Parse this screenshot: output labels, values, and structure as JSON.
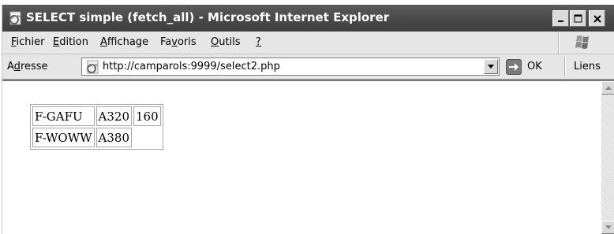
{
  "window": {
    "title": "SELECT simple (fetch_all) - Microsoft Internet Explorer"
  },
  "menu": [
    {
      "pre": "",
      "ul": "F",
      "post": "ichier"
    },
    {
      "pre": "",
      "ul": "E",
      "post": "dition"
    },
    {
      "pre": "",
      "ul": "A",
      "post": "ffichage"
    },
    {
      "pre": "Fa",
      "ul": "v",
      "post": "oris"
    },
    {
      "pre": "",
      "ul": "O",
      "post": "utils"
    },
    {
      "pre": "",
      "ul": "?",
      "post": ""
    }
  ],
  "address": {
    "label_pre": "A",
    "label_ul": "d",
    "label_post": "resse",
    "url": "http://camparols:9999/select2.php",
    "go_label": "OK",
    "links_label": "Liens"
  },
  "table": {
    "rows": [
      [
        "F-GAFU",
        "A320",
        "160"
      ],
      [
        "F-WOWW",
        "A380",
        ""
      ]
    ]
  },
  "icons": {
    "app": "ie-page-icon",
    "minimize": "minimize-icon",
    "maximize": "maximize-icon",
    "close": "close-icon",
    "go": "go-arrow-icon",
    "dropdown": "chevron-down-icon",
    "scroll_up": "scroll-up-icon",
    "scroll_down": "scroll-down-icon",
    "windows_logo": "windows-logo-icon"
  }
}
